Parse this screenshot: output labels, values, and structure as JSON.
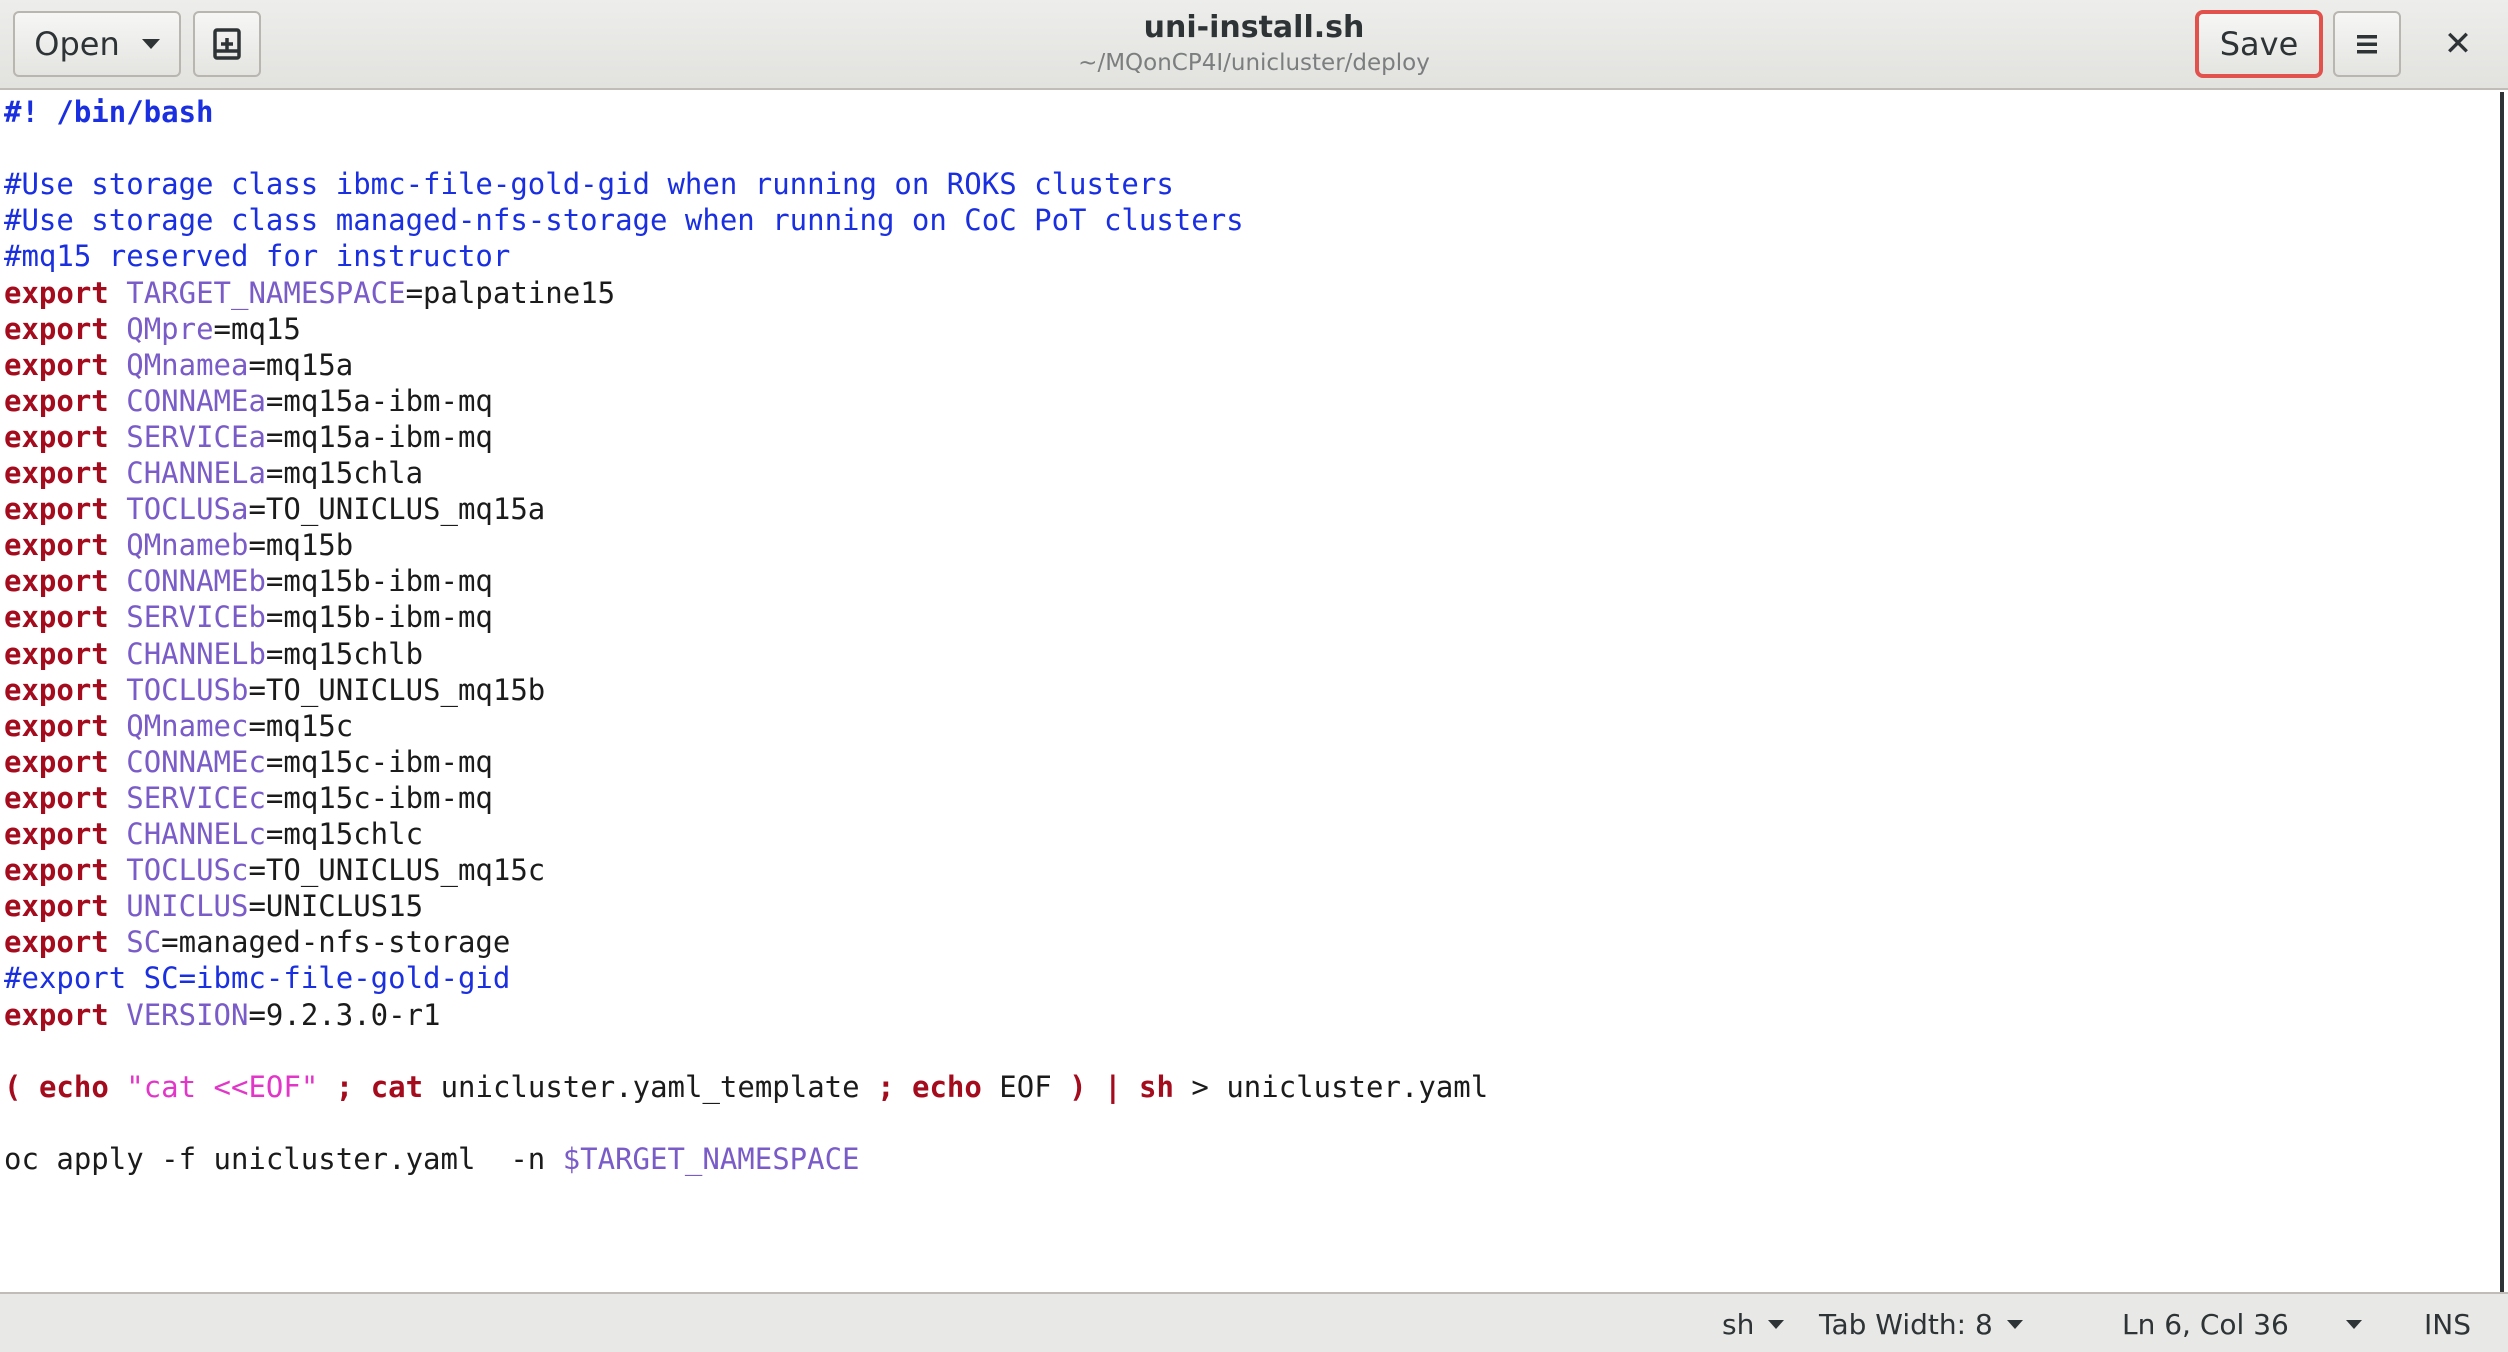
{
  "header": {
    "open_label": "Open",
    "save_label": "Save",
    "title": "uni-install.sh",
    "subtitle": "~/MQonCP4I/unicluster/deploy"
  },
  "editor": {
    "lines": [
      "#! /bin/bash",
      "",
      "#Use storage class ibmc-file-gold-gid when running on ROKS clusters",
      "#Use storage class managed-nfs-storage when running on CoC PoT clusters",
      "#mq15 reserved for instructor",
      "export TARGET_NAMESPACE=palpatine15",
      "export QMpre=mq15",
      "export QMnamea=mq15a",
      "export CONNAMEa=mq15a-ibm-mq",
      "export SERVICEa=mq15a-ibm-mq",
      "export CHANNELa=mq15chla",
      "export TOCLUSa=TO_UNICLUS_mq15a",
      "export QMnameb=mq15b",
      "export CONNAMEb=mq15b-ibm-mq",
      "export SERVICEb=mq15b-ibm-mq",
      "export CHANNELb=mq15chlb",
      "export TOCLUSb=TO_UNICLUS_mq15b",
      "export QMnamec=mq15c",
      "export CONNAMEc=mq15c-ibm-mq",
      "export SERVICEc=mq15c-ibm-mq",
      "export CHANNELc=mq15chlc",
      "export TOCLUSc=TO_UNICLUS_mq15c",
      "export UNICLUS=UNICLUS15",
      "export SC=managed-nfs-storage",
      "#export SC=ibmc-file-gold-gid",
      "export VERSION=9.2.3.0-r1",
      "",
      "( echo \"cat <<EOF\" ; cat unicluster.yaml_template ; echo EOF ) | sh > unicluster.yaml",
      "",
      "oc apply -f unicluster.yaml  -n $TARGET_NAMESPACE"
    ]
  },
  "statusbar": {
    "language": "sh",
    "tab_width": "Tab Width: 8",
    "cursor_position": "Ln 6, Col 36",
    "insert_mode": "INS"
  },
  "colors": {
    "keyword": "#a40c1e",
    "variable": "#7a5cc9",
    "comment": "#1a2fe0",
    "string": "#e236c8",
    "save_highlight": "#e2514c"
  },
  "icons": [
    "chevron-down-icon",
    "document-icon",
    "hamburger-menu-icon",
    "close-icon"
  ]
}
